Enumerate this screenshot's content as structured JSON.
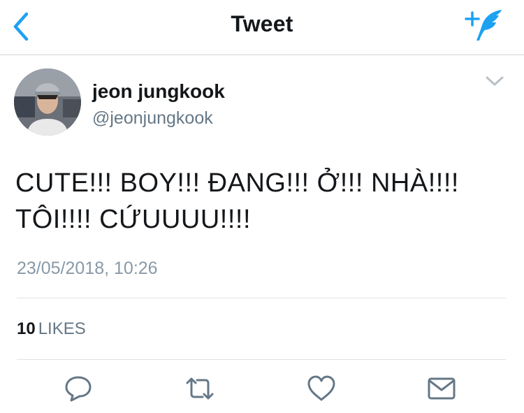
{
  "header": {
    "title": "Tweet",
    "back_icon": "back-chevron-icon",
    "compose_icon": "compose-feather-icon",
    "accent": "#1da1f2"
  },
  "author": {
    "name": "jeon jungkook",
    "handle": "@jeonjungkook",
    "avatar_icon": "avatar-photo",
    "menu_icon": "chevron-down-icon"
  },
  "tweet": {
    "text": "CUTE!!! BOY!!! ĐANG!!! Ở!!! NHÀ!!!! TÔI!!!! CỨUUUU!!!!",
    "timestamp": "23/05/2018, 10:26"
  },
  "stats": {
    "likes_count": "10",
    "likes_label": "LIKES"
  },
  "actions": [
    {
      "name": "reply",
      "icon": "reply-bubble-icon"
    },
    {
      "name": "retweet",
      "icon": "retweet-arrows-icon"
    },
    {
      "name": "like",
      "icon": "heart-icon"
    },
    {
      "name": "share",
      "icon": "envelope-icon"
    }
  ],
  "colors": {
    "icon_gray": "#657786",
    "meta_gray": "#8899a6",
    "text": "#14171a"
  }
}
